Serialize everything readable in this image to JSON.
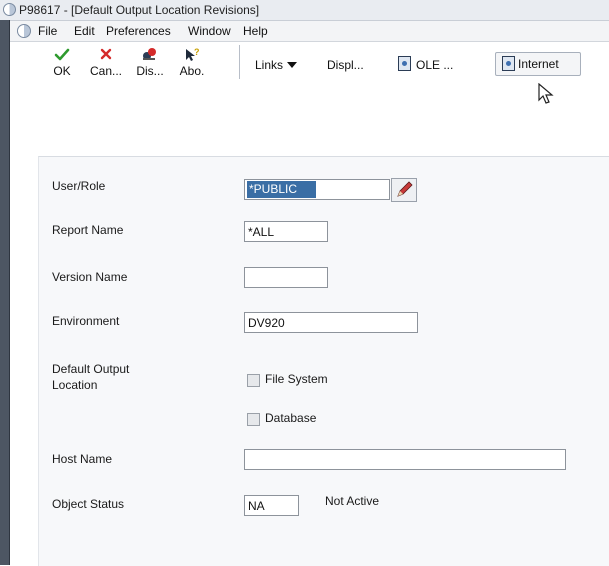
{
  "window": {
    "title": "P98617 - [Default Output Location Revisions]"
  },
  "menu": {
    "items": [
      "File",
      "Edit",
      "Preferences",
      "Window",
      "Help"
    ]
  },
  "toolbar": {
    "ok_label": "OK",
    "cancel_label": "Can...",
    "dis_label": "Dis...",
    "abo_label": "Abo.",
    "links_label": "Links",
    "display_label": "Displ...",
    "ole_label": "OLE ...",
    "internet_label": "Internet"
  },
  "form": {
    "user_role": {
      "label": "User/Role",
      "value": "*PUBLIC"
    },
    "report_name": {
      "label": "Report Name",
      "value": "*ALL"
    },
    "version_name": {
      "label": "Version Name",
      "value": ""
    },
    "environment": {
      "label": "Environment",
      "value": "DV920"
    },
    "default_output_location": {
      "label_line1": "Default Output",
      "label_line2": "Location",
      "file_system_label": "File System",
      "file_system_checked": false,
      "database_label": "Database",
      "database_checked": false
    },
    "host_name": {
      "label": "Host Name",
      "value": ""
    },
    "object_status": {
      "label": "Object Status",
      "value": "NA",
      "description": "Not Active"
    }
  },
  "icons": [
    "app-icon",
    "checkmark-icon",
    "cancel-x-icon",
    "display-icon",
    "about-icon",
    "dropdown-triangle-icon",
    "document-icon",
    "lookup-pencil-icon",
    "mouse-cursor-icon"
  ],
  "colors": {
    "ok_green": "#2e9a2e",
    "cancel_red": "#d42a2a",
    "selection_blue": "#3a6ea5"
  }
}
